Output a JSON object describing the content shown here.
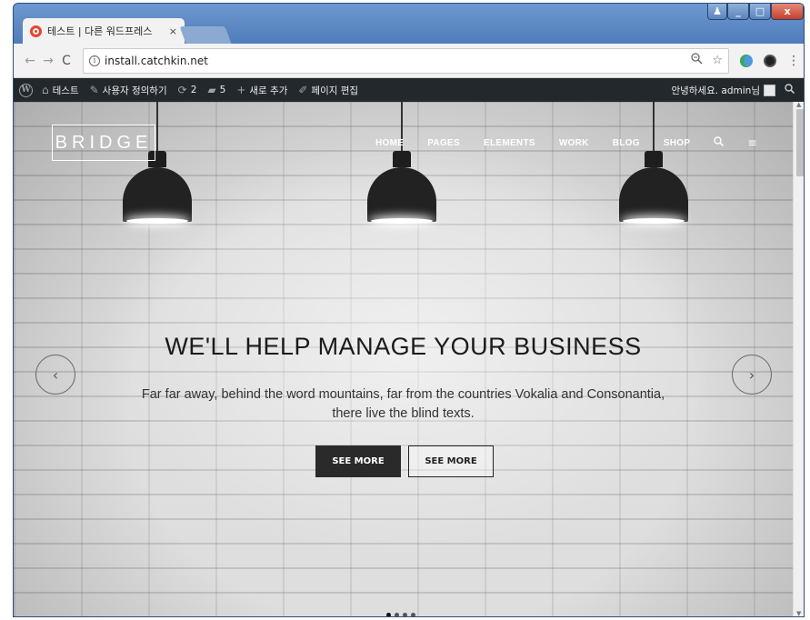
{
  "browser": {
    "tab_title": "테스트 | 다른 워드프레스",
    "tab_close": "×",
    "url": "install.catchkin.net",
    "nav": {
      "back": "←",
      "forward": "→",
      "reload": "C"
    },
    "info_glyph": "i",
    "icons": {
      "zoom": "zoom-icon",
      "star": "star-icon",
      "menu": "⋮"
    }
  },
  "window_controls": {
    "user": "♟",
    "minimize": "_",
    "maximize": "□",
    "close": "x"
  },
  "admin_bar": {
    "wp_glyph": "W",
    "site_name": "테스트",
    "customize": "사용자 정의하기",
    "updates_count": "2",
    "comments_count": "5",
    "new_label": "새로 추가",
    "edit_page": "페이지 편집",
    "greeting": "안녕하세요. admin님"
  },
  "site": {
    "logo": "BRIDGE",
    "nav": [
      "HOME",
      "PAGES",
      "ELEMENTS",
      "WORK",
      "BLOG",
      "SHOP"
    ],
    "hero_title": "WE'LL HELP MANAGE YOUR BUSINESS",
    "hero_text_line1": "Far far away, behind the word mountains, far from the countries Vokalia and Consonantia,",
    "hero_text_line2": "there live the blind texts.",
    "button_primary": "SEE MORE",
    "button_secondary": "SEE MORE",
    "arrow_left": "‹",
    "arrow_right": "›",
    "slides": 4,
    "active_slide": 1
  },
  "colors": {
    "admin_bar": "#23282d",
    "window_frame": "#4a78b4",
    "button_dark": "#2a2a2a"
  }
}
